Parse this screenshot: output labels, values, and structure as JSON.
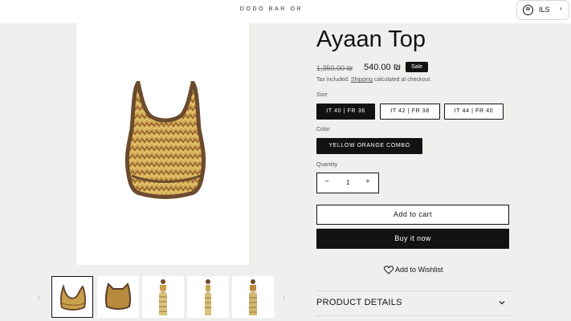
{
  "header": {
    "brand": "DODO BAR OR",
    "currency": {
      "icon": "israel-flag-icon",
      "code": "ILS",
      "arrow": "›"
    }
  },
  "gallery": {
    "prev": "‹",
    "next": "›",
    "thumbnails": [
      {
        "name": "top-front",
        "active": true
      },
      {
        "name": "top-back",
        "active": false
      },
      {
        "name": "model-front",
        "active": false
      },
      {
        "name": "model-side",
        "active": false
      },
      {
        "name": "model-back",
        "active": false
      }
    ]
  },
  "product": {
    "title": "Ayaan Top",
    "old_price": "1,350.00 ₪",
    "price": "540.00 ₪",
    "badge": "Sale",
    "tax_prefix": "Tax included.",
    "tax_link": "Shipping",
    "tax_suffix": "calculated at checkout."
  },
  "options": {
    "size_label": "Size",
    "sizes": [
      "IT 40 | FR 36",
      "IT 42 | FR 38",
      "IT 44 | FR 40"
    ],
    "selected_size": "IT 40 | FR 36",
    "color_label": "Color",
    "colors": [
      "YELLOW ORANGE COMBO"
    ],
    "quantity_label": "Quantity",
    "quantity": "1",
    "minus": "−",
    "plus": "+"
  },
  "actions": {
    "add_to_cart": "Add to cart",
    "buy_now": "Buy it now",
    "wishlist": "Add to Wishlist"
  },
  "details": {
    "title": "PRODUCT DETAILS"
  },
  "colors": {
    "accent": "#121212",
    "background": "#efefed",
    "top_fabric": "#c79b47",
    "top_trim": "#6b4a2e"
  }
}
